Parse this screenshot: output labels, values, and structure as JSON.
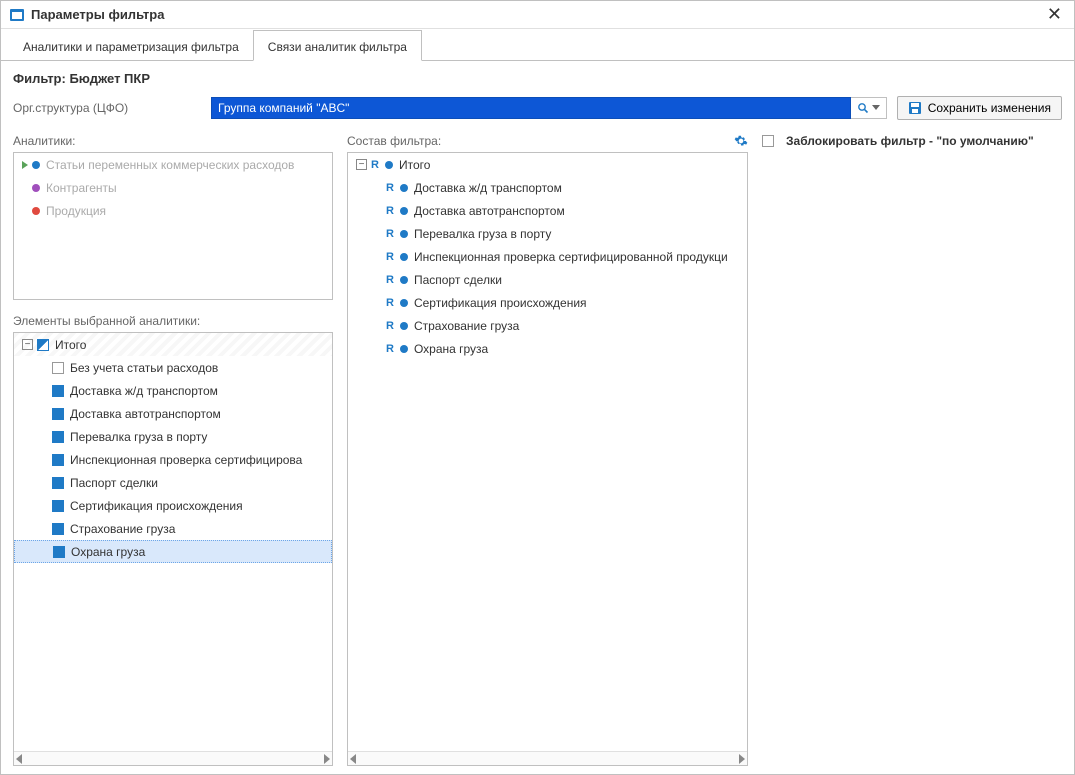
{
  "window": {
    "title": "Параметры фильтра"
  },
  "tabs": [
    {
      "label": "Аналитики и параметризация фильтра"
    },
    {
      "label": "Связи аналитик фильтра"
    }
  ],
  "filter_header": "Фильтр: Бюджет ПКР",
  "org": {
    "label": "Орг.структура (ЦФО)",
    "value": "Группа компаний \"ABC\""
  },
  "save_button": "Сохранить изменения",
  "analytics": {
    "title": "Аналитики:",
    "items": [
      {
        "label": "Статьи переменных коммерческих расходов",
        "color": "blue",
        "dim": true,
        "arrow": true
      },
      {
        "label": "Контрагенты",
        "color": "purple",
        "dim": true
      },
      {
        "label": "Продукция",
        "color": "red",
        "dim": true
      }
    ]
  },
  "elements": {
    "title": "Элементы выбранной аналитики:",
    "root": {
      "label": "Итого",
      "state": "mixed"
    },
    "items": [
      {
        "label": "Без учета статьи расходов",
        "checked": false
      },
      {
        "label": "Доставка ж/д транспортом",
        "checked": true
      },
      {
        "label": "Доставка автотранспортом",
        "checked": true
      },
      {
        "label": "Перевалка груза в порту",
        "checked": true
      },
      {
        "label": "Инспекционная проверка сертифицирова",
        "checked": true
      },
      {
        "label": "Паспорт сделки",
        "checked": true
      },
      {
        "label": "Сертификация происхождения",
        "checked": true
      },
      {
        "label": "Страхование груза",
        "checked": true
      },
      {
        "label": "Охрана груза",
        "checked": true,
        "selected": true
      }
    ]
  },
  "filter_content": {
    "title": "Состав фильтра:",
    "root": {
      "label": "Итого"
    },
    "items": [
      {
        "label": "Доставка ж/д транспортом"
      },
      {
        "label": "Доставка автотранспортом"
      },
      {
        "label": "Перевалка груза в порту"
      },
      {
        "label": "Инспекционная проверка сертифицированной продукци"
      },
      {
        "label": "Паспорт сделки"
      },
      {
        "label": "Сертификация происхождения"
      },
      {
        "label": "Страхование груза"
      },
      {
        "label": "Охрана груза"
      }
    ]
  },
  "lock_filter": {
    "label": "Заблокировать фильтр - \"по умолчанию\"",
    "checked": false
  }
}
